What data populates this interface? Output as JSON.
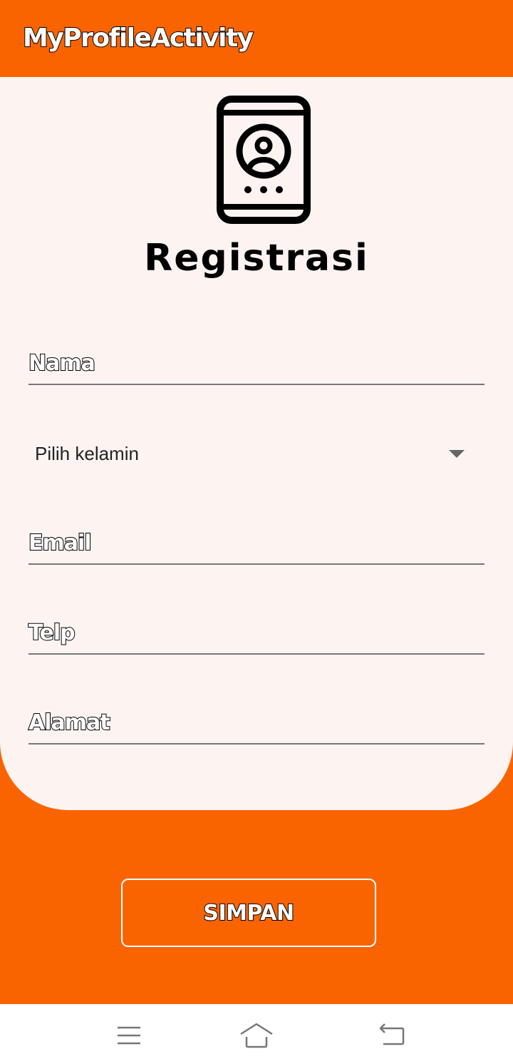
{
  "app_bar": {
    "title": "MyProfileActivity"
  },
  "colors": {
    "accent": "#FA6400",
    "card_background": "#FDF4F2",
    "nav_bar": "#FFFFFF"
  },
  "header": {
    "logo_icon": "smartphone-contact-icon",
    "title": "Registrasi"
  },
  "form": {
    "nama_hint": "Nama",
    "gender_selected": "Pilih kelamin",
    "email_hint": "Email",
    "telp_hint": "Telp",
    "alamat_hint": "Alamat"
  },
  "actions": {
    "save_label": "SIMPAN"
  },
  "nav": {
    "menu_icon": "menu-icon",
    "home_icon": "home-icon",
    "back_icon": "back-icon"
  }
}
